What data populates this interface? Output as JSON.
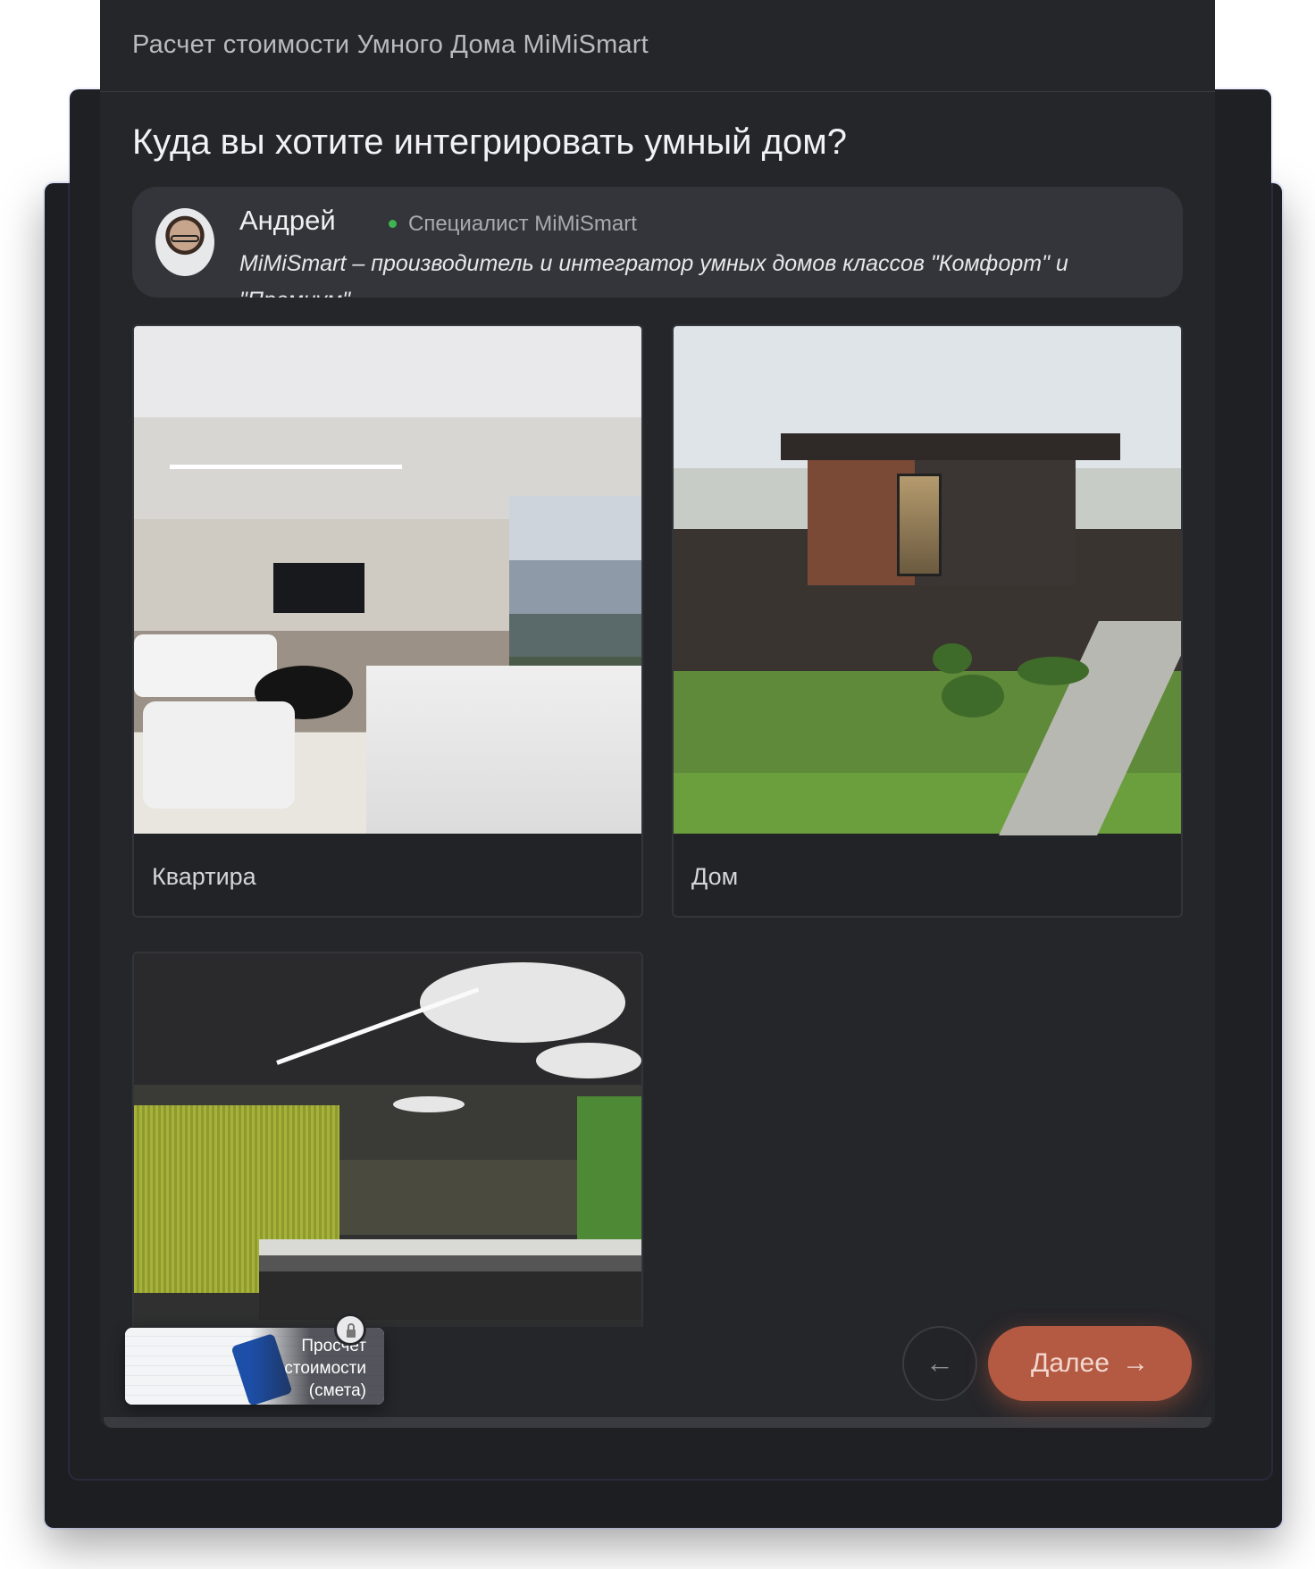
{
  "header": {
    "title": "Расчет стоимости Умного Дома MiMiSmart"
  },
  "question": "Куда вы хотите интегрировать умный дом?",
  "expert": {
    "name": "Андрей",
    "role": "Специалист MiMiSmart",
    "message": "MiMiSmart – производитель и интегратор умных домов классов \"Комфорт\" и \"Премиум\""
  },
  "options": [
    {
      "label": "Квартира"
    },
    {
      "label": "Дом"
    },
    {
      "label": ""
    }
  ],
  "promo": {
    "text": "Просчет стоимости (смета)"
  },
  "nav": {
    "back_icon": "←",
    "next_label": "Далее",
    "next_icon": "→"
  },
  "colors": {
    "accent": "#b45a43",
    "online": "#3fb54f",
    "panel": "#25262a"
  }
}
